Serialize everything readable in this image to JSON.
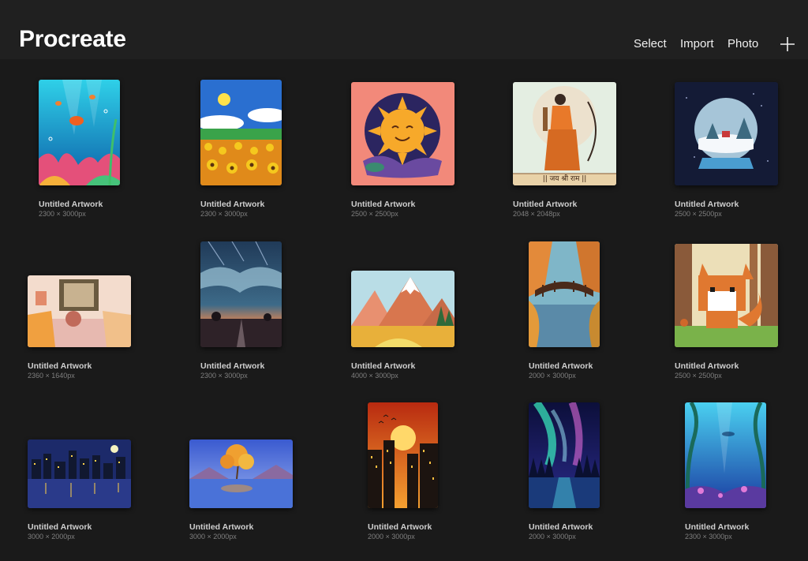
{
  "header": {
    "title": "Procreate",
    "select_label": "Select",
    "import_label": "Import",
    "photo_label": "Photo",
    "add_icon": "plus-icon"
  },
  "gallery": {
    "artworks": [
      {
        "name": "Untitled Artwork",
        "dims": "2300 × 3000px",
        "subject": "underwater-coral"
      },
      {
        "name": "Untitled Artwork",
        "dims": "2300 × 3000px",
        "subject": "sunflower-field"
      },
      {
        "name": "Untitled Artwork",
        "dims": "2500 × 2500px",
        "subject": "smiling-sun"
      },
      {
        "name": "Untitled Artwork",
        "dims": "2048 × 2048px",
        "subject": "archer-illustration",
        "caption": "|| जय श्री राम ||"
      },
      {
        "name": "Untitled Artwork",
        "dims": "2500 × 2500px",
        "subject": "snow-globe"
      },
      {
        "name": "Untitled Artwork",
        "dims": "2360 × 1640px",
        "subject": "cozy-room"
      },
      {
        "name": "Untitled Artwork",
        "dims": "2300 × 3000px",
        "subject": "stormy-sunset-road"
      },
      {
        "name": "Untitled Artwork",
        "dims": "4000 × 3000px",
        "subject": "mountain-landscape"
      },
      {
        "name": "Untitled Artwork",
        "dims": "2000 × 3000px",
        "subject": "autumn-bridge"
      },
      {
        "name": "Untitled Artwork",
        "dims": "2500 × 2500px",
        "subject": "pixel-fox"
      },
      {
        "name": "Untitled Artwork",
        "dims": "3000 × 2000px",
        "subject": "night-city-skyline"
      },
      {
        "name": "Untitled Artwork",
        "dims": "3000 × 2000px",
        "subject": "golden-tree-lake"
      },
      {
        "name": "Untitled Artwork",
        "dims": "2000 × 3000px",
        "subject": "sunset-city"
      },
      {
        "name": "Untitled Artwork",
        "dims": "2000 × 3000px",
        "subject": "aurora-forest"
      },
      {
        "name": "Untitled Artwork",
        "dims": "2300 × 3000px",
        "subject": "kelp-underwater"
      }
    ]
  }
}
